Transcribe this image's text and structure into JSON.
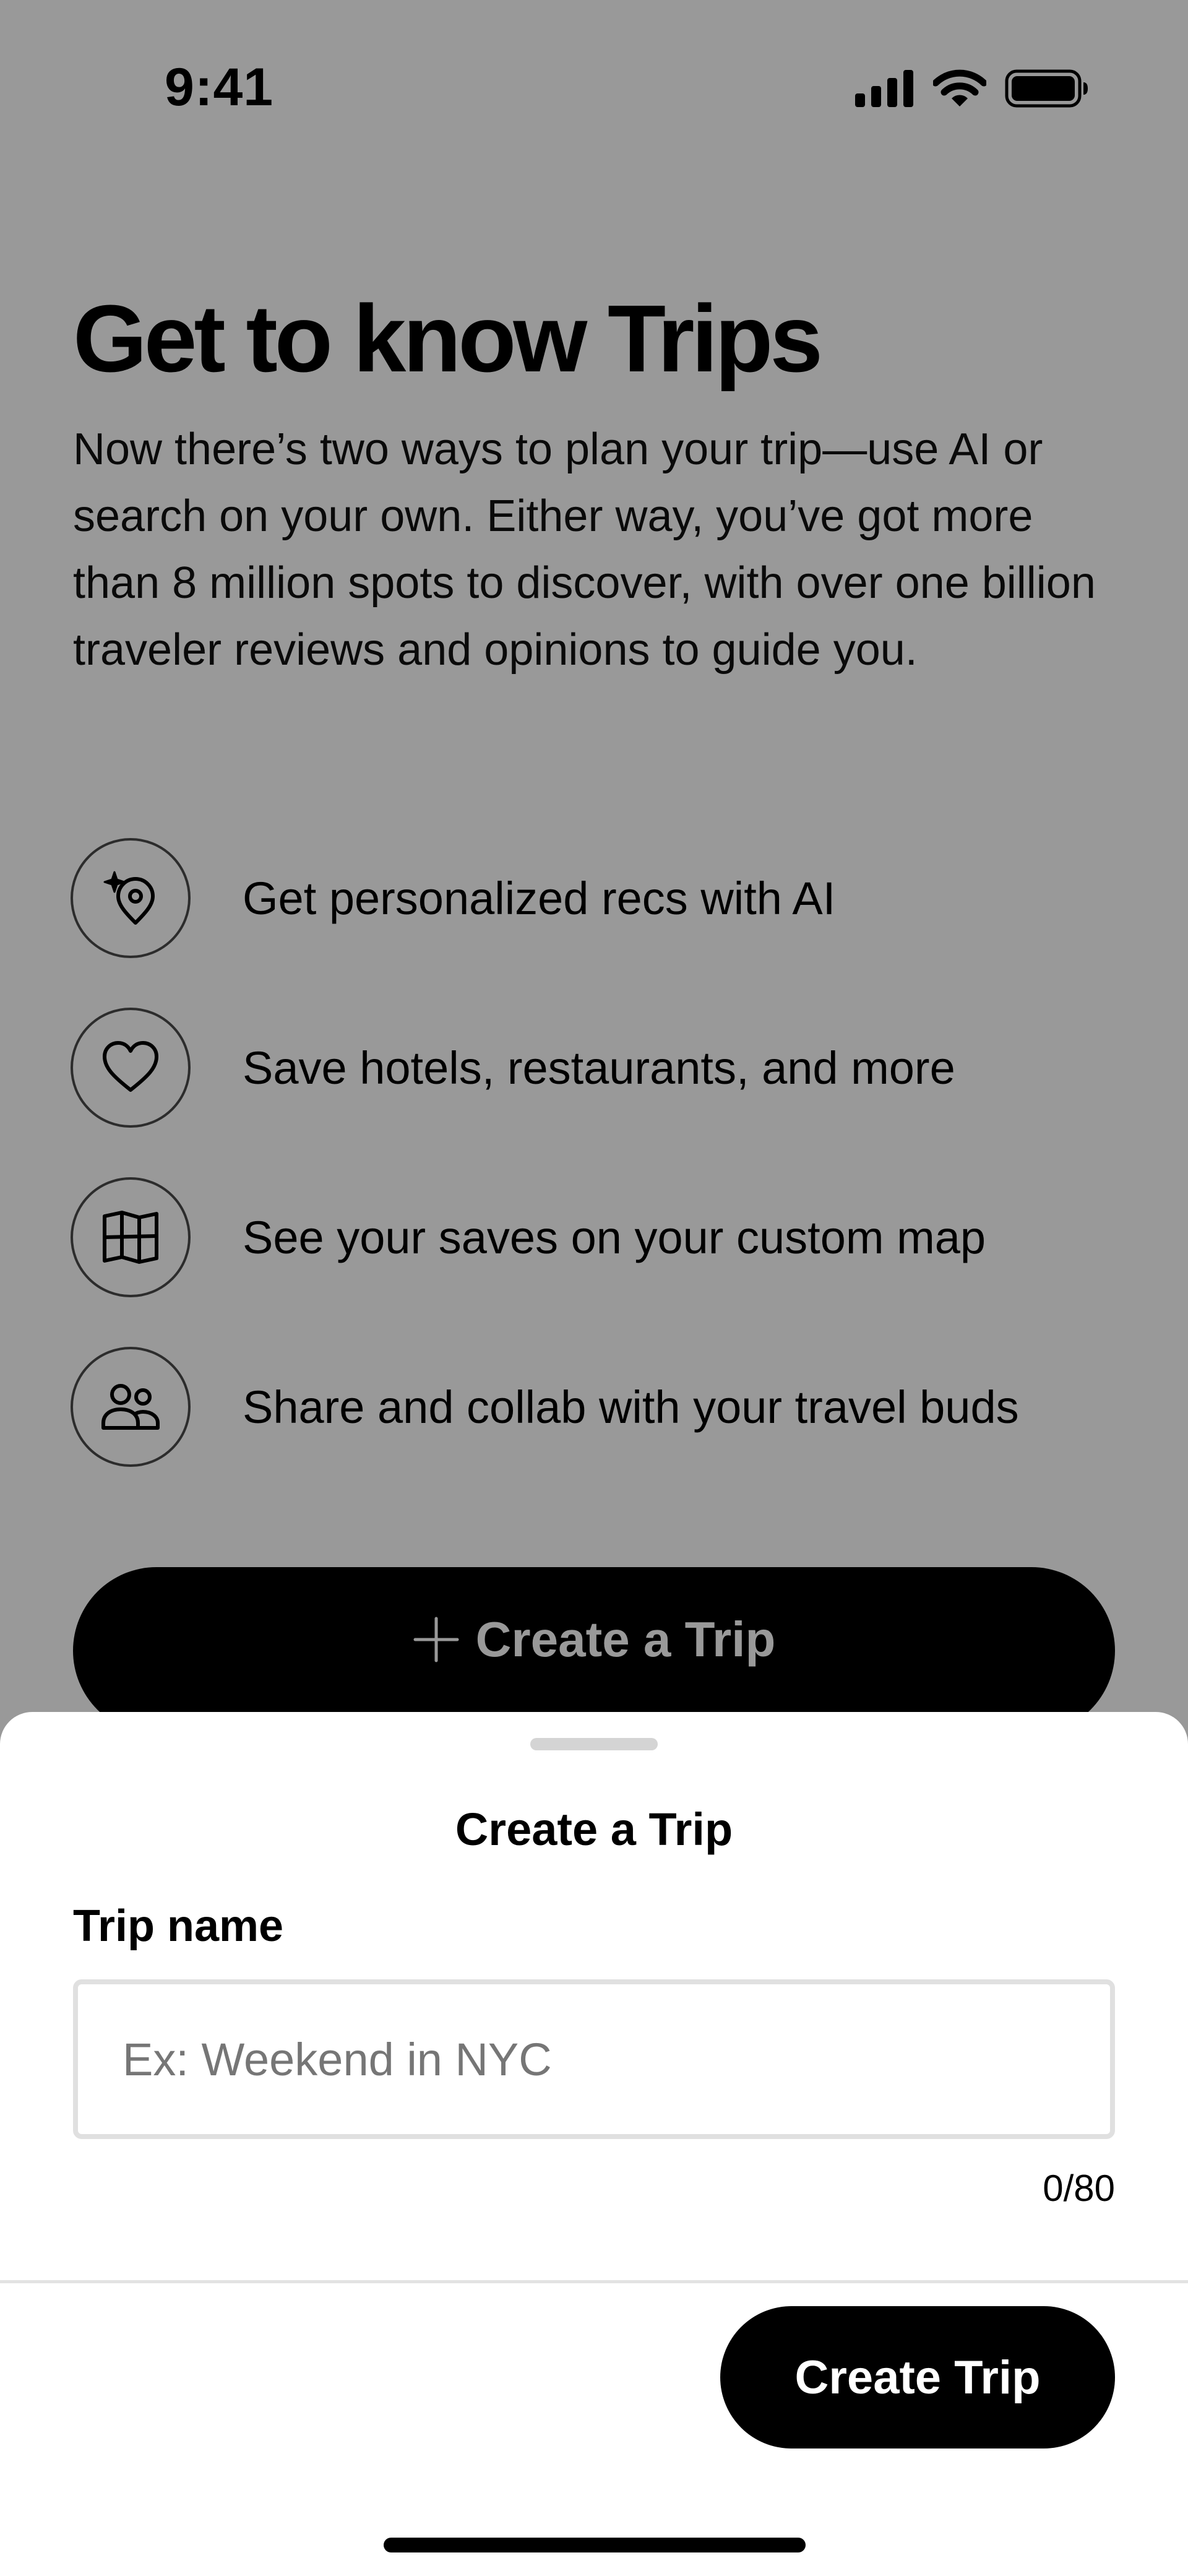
{
  "status_bar": {
    "time": "9:41",
    "icons": [
      "cellular-signal-icon",
      "wifi-icon",
      "battery-icon"
    ]
  },
  "page": {
    "title": "Get to know Trips",
    "description": "Now there’s two ways to plan your trip—use AI or search on your own. Either way, you’ve got more than 8 million spots to discover, with over one billion traveler reviews and opinions to guide you.",
    "features": [
      {
        "icon": "ai-sparkle-pin-icon",
        "label": "Get personalized recs with AI"
      },
      {
        "icon": "heart-icon",
        "label": "Save hotels, restaurants, and more"
      },
      {
        "icon": "map-icon",
        "label": "See your saves on your custom map"
      },
      {
        "icon": "people-icon",
        "label": "Share and collab with your travel buds"
      }
    ],
    "primary_cta_label": "Create a Trip"
  },
  "sheet": {
    "title": "Create a Trip",
    "field_label": "Trip name",
    "input": {
      "value": "",
      "placeholder": "Ex: Weekend in NYC"
    },
    "char_count": "0/80",
    "submit_label": "Create Trip"
  },
  "colors": {
    "primary": "#000000",
    "scrim": "rgba(0,0,0,0.40)",
    "input_border": "#e0e0e0",
    "placeholder": "#767676"
  }
}
